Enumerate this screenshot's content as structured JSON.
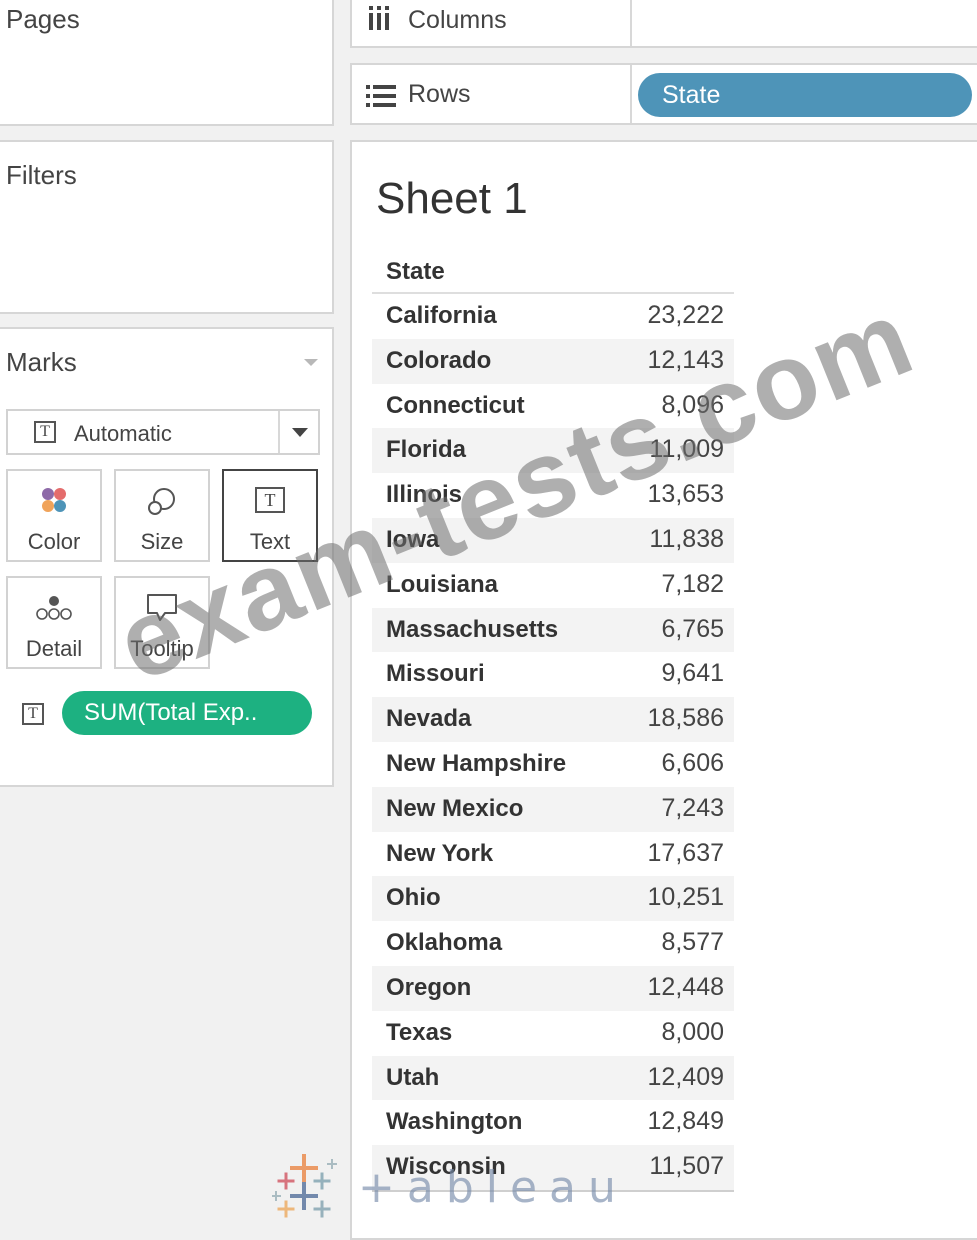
{
  "panels": {
    "pages_title": "Pages",
    "filters_title": "Filters",
    "marks_title": "Marks"
  },
  "marks": {
    "mark_type": "Automatic",
    "buttons": {
      "color": "Color",
      "size": "Size",
      "text": "Text",
      "detail": "Detail",
      "tooltip": "Tooltip"
    },
    "text_field_pill": "SUM(Total Exp..",
    "pill_color": "#1db181",
    "color_dots": [
      "#8e6aa8",
      "#e46c6c",
      "#f0a35a",
      "#4e94b8"
    ]
  },
  "shelves": {
    "columns_label": "Columns",
    "rows_label": "Rows",
    "rows_pill": "State",
    "rows_pill_color": "#4e94b8"
  },
  "view": {
    "sheet_title": "Sheet 1",
    "column_header": "State",
    "rows": [
      {
        "state": "California",
        "value": "23,222"
      },
      {
        "state": "Colorado",
        "value": "12,143"
      },
      {
        "state": "Connecticut",
        "value": "8,096"
      },
      {
        "state": "Florida",
        "value": "11,009"
      },
      {
        "state": "Illinois",
        "value": "13,653"
      },
      {
        "state": "Iowa",
        "value": "11,838"
      },
      {
        "state": "Louisiana",
        "value": "7,182"
      },
      {
        "state": "Massachusetts",
        "value": "6,765"
      },
      {
        "state": "Missouri",
        "value": "9,641"
      },
      {
        "state": "Nevada",
        "value": "18,586"
      },
      {
        "state": "New Hampshire",
        "value": "6,606"
      },
      {
        "state": "New Mexico",
        "value": "7,243"
      },
      {
        "state": "New York",
        "value": "17,637"
      },
      {
        "state": "Ohio",
        "value": "10,251"
      },
      {
        "state": "Oklahoma",
        "value": "8,577"
      },
      {
        "state": "Oregon",
        "value": "12,448"
      },
      {
        "state": "Texas",
        "value": "8,000"
      },
      {
        "state": "Utah",
        "value": "12,409"
      },
      {
        "state": "Washington",
        "value": "12,849"
      },
      {
        "state": "Wisconsin",
        "value": "11,507"
      }
    ]
  },
  "watermark": "exam-tests.com",
  "logo": {
    "wordmark": "+ableau"
  }
}
